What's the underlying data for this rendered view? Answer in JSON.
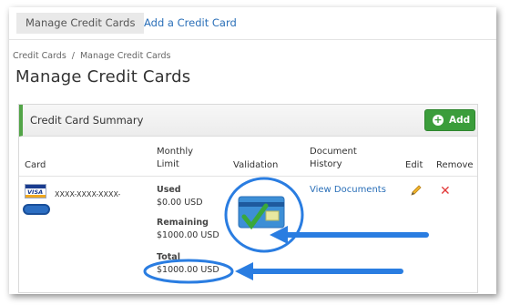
{
  "topnav": {
    "active_tab": "Manage Credit Cards",
    "link_tab": "Add a Credit Card"
  },
  "breadcrumb": {
    "root": "Credit Cards",
    "separator": "/",
    "current": "Manage Credit Cards"
  },
  "page": {
    "title": "Manage Credit Cards"
  },
  "panel": {
    "title": "Credit Card Summary",
    "add_label": "Add",
    "columns": {
      "card": "Card",
      "monthly_line1": "Monthly",
      "monthly_line2": "Limit",
      "validation": "Validation",
      "doc_line1": "Document",
      "doc_line2": "History",
      "edit": "Edit",
      "remove": "Remove"
    },
    "row": {
      "card_brand": "VISA",
      "card_number": "XXXX-XXXX-XXXX-",
      "used_label": "Used",
      "used_value": "$0.00 USD",
      "remaining_label": "Remaining",
      "remaining_value": "$1000.00 USD",
      "total_label": "Total",
      "total_value": "$1000.00 USD",
      "view_documents": "View Documents",
      "edit_icon": "pencil-icon",
      "remove_icon": "remove-x-icon",
      "validation_icon": "validated-card-checkmark-icon"
    }
  },
  "colors": {
    "accent_green": "#3b9d3b",
    "link_blue": "#2a6fb8",
    "annotation_blue": "#2a7de1",
    "remove_red": "#e23a3a"
  }
}
